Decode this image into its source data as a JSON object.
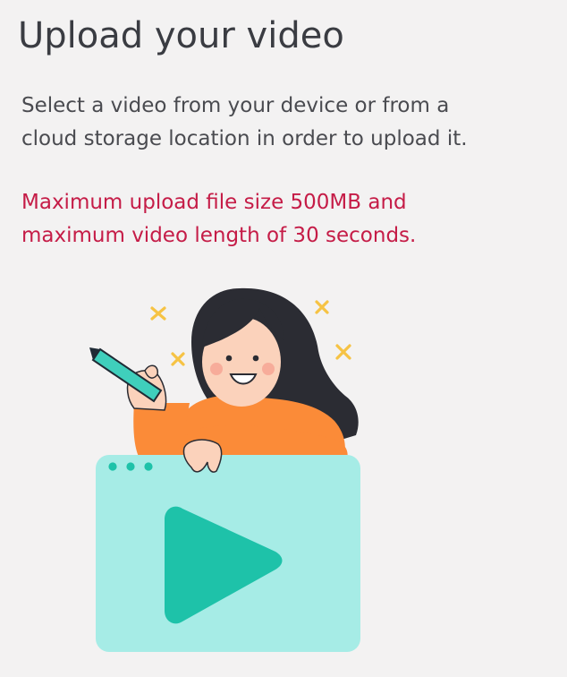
{
  "header": {
    "title": "Upload your video"
  },
  "content": {
    "description_lines": [
      "Select a video from your device or from a",
      "cloud storage location in order to upload it."
    ],
    "limits_lines": [
      "Maximum upload file size 500MB and",
      "maximum video length of 30 seconds."
    ]
  },
  "illustration": {
    "icons": [
      "sparkle-x-icon",
      "pencil-icon",
      "window-dots-icon",
      "play-icon"
    ],
    "colors": {
      "window": "#a6ece6",
      "play": "#1ec2a9",
      "sweater": "#fb8b38",
      "hair": "#2b2c33",
      "skin": "#fbd2bb",
      "sparkle": "#f6c344",
      "limits_text": "#c51c47"
    }
  }
}
